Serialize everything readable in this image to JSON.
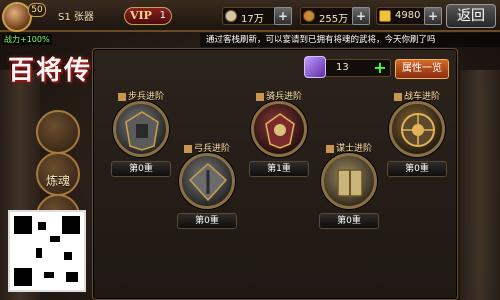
{
  "player": {
    "level": "50",
    "name": "S1 张器",
    "battle_text": "战力+100%"
  },
  "vip": {
    "label": "VIP",
    "level": "1"
  },
  "resources": [
    {
      "name": "copper",
      "value": "17万",
      "icon": "coin-icon",
      "color": "#d9c7a3"
    },
    {
      "name": "food",
      "value": "255万",
      "icon": "grain-icon",
      "color": "#c68a3a"
    },
    {
      "name": "gold",
      "value": "4980",
      "icon": "gold-ingot-icon",
      "color": "#f0c23a"
    }
  ],
  "back_label": "返回",
  "ticker": "通过客栈刷新，可以宴请到已拥有将魂的武将，今天你刷了吗",
  "logo_text": "百将传说",
  "left_nav": [
    {
      "label": "",
      "icon": "armor-icon"
    },
    {
      "label": "炼魂",
      "icon": "soul-icon"
    },
    {
      "label": "",
      "icon": "cart-icon"
    }
  ],
  "panel": {
    "gem_value": "13",
    "attr_button": "属性一览",
    "units": [
      {
        "key": "infantry",
        "title": "步兵进阶",
        "rank": "第0重"
      },
      {
        "key": "archer",
        "title": "弓兵进阶",
        "rank": "第0重"
      },
      {
        "key": "cavalry",
        "title": "骑兵进阶",
        "rank": "第1重"
      },
      {
        "key": "strategist",
        "title": "谋士进阶",
        "rank": "第0重"
      },
      {
        "key": "chariot",
        "title": "战车进阶",
        "rank": "第0重"
      }
    ]
  },
  "colors": {
    "accent": "#c9a04a",
    "panel_border": "#6a4d2d",
    "gem": "#5b2ca6"
  }
}
